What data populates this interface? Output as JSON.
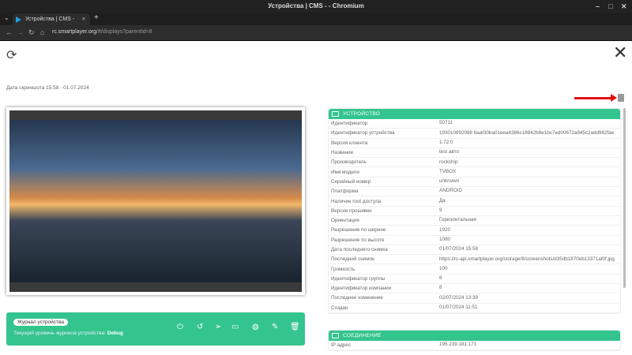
{
  "window": {
    "title": "Устройства | CMS - - Chromium"
  },
  "tab": {
    "label": "Устройства | CMS -",
    "close": "×",
    "new": "+"
  },
  "nav": {
    "url_host": "rc.smartplayer.org",
    "url_path": "/#/displays?parentId=8"
  },
  "page": {
    "screenshot_date": "Дата скриншота 15:58 - 01.07.2024",
    "close": "✕",
    "refresh": "⟳"
  },
  "log": {
    "button": "Журнал устройства",
    "level_label": "Текущий уровень журнала устройства: ",
    "level": "Debug"
  },
  "device": {
    "title": "УСТРОЙСТВО",
    "rows": [
      {
        "k": "Идентификатор",
        "v": "50711"
      },
      {
        "k": "Идентификатор устройства",
        "v": "193010892088 6aaf30ba01eea4386c18842b8e1bc7ed00672a945c2add982fae"
      },
      {
        "k": "Версия клиента",
        "v": "1.72.0"
      },
      {
        "k": "Название",
        "v": "test авто"
      },
      {
        "k": "Производитель",
        "v": "rockchip"
      },
      {
        "k": "Имя модели",
        "v": "TVBOX"
      },
      {
        "k": "Серийный номер",
        "v": "unknown"
      },
      {
        "k": "Платформа",
        "v": "ANDROID"
      },
      {
        "k": "Наличие root доступа",
        "v": "Да"
      },
      {
        "k": "Версия прошивки",
        "v": "9"
      },
      {
        "k": "Ориентация",
        "v": "Горизонтальная"
      },
      {
        "k": "Разрешение по ширине",
        "v": "1920"
      },
      {
        "k": "Разрешение по высоте",
        "v": "1080"
      },
      {
        "k": "Дата последнего снимка",
        "v": "01/07/2024 15:58"
      },
      {
        "k": "Последний снимок",
        "v": "https://rc-api.smartplayer.org/storage/8/screenshots/d35db1870eb13371af0f.jpg"
      },
      {
        "k": "Громкость",
        "v": "100"
      },
      {
        "k": "Идентификатор группы",
        "v": "8"
      },
      {
        "k": "Идентификатор компании",
        "v": "8"
      },
      {
        "k": "Последнее изменение",
        "v": "02/07/2024 13:39"
      },
      {
        "k": "Создан",
        "v": "01/07/2024 11:51"
      }
    ]
  },
  "connection": {
    "title": "СОЕДИНЕНИЕ",
    "rows": [
      {
        "k": "IP адрес",
        "v": "195.239.181.171"
      }
    ]
  }
}
